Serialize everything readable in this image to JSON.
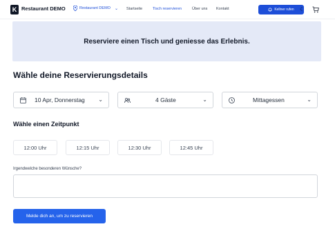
{
  "header": {
    "brand": "Restaurant DEMO",
    "location": "Restaurant DEMO",
    "nav": [
      "Startseite",
      "Tisch reservieren",
      "Über uns",
      "Kontakt"
    ],
    "active_nav": "Tisch reservieren",
    "call_button": "Kellner rufen"
  },
  "hero": {
    "title": "Reserviere einen Tisch und geniesse das Erlebnis."
  },
  "details": {
    "heading": "Wähle deine Reservierungsdetails",
    "date": "10 Apr, Donnerstag",
    "guests": "4 Gäste",
    "meal": "Mittagessen"
  },
  "time": {
    "heading": "Wähle einen Zeitpunkt",
    "slots": [
      "12:00 Uhr",
      "12:15 Uhr",
      "12:30 Uhr",
      "12:45 Uhr"
    ]
  },
  "wishes": {
    "label": "Irgendwelche besonderen Wünsche?",
    "value": ""
  },
  "submit": {
    "label": "Melde dich an, um zu reservieren"
  },
  "colors": {
    "primary": "#1d4ed8",
    "hero_bg": "#e4e9f7"
  },
  "icons": {
    "logo": "k-logo-icon",
    "location": "map-pin-icon",
    "call": "bell-icon",
    "theme": "moon-icon",
    "cart": "cart-icon",
    "date": "calendar-icon",
    "guests": "users-icon",
    "meal": "clock-icon"
  }
}
